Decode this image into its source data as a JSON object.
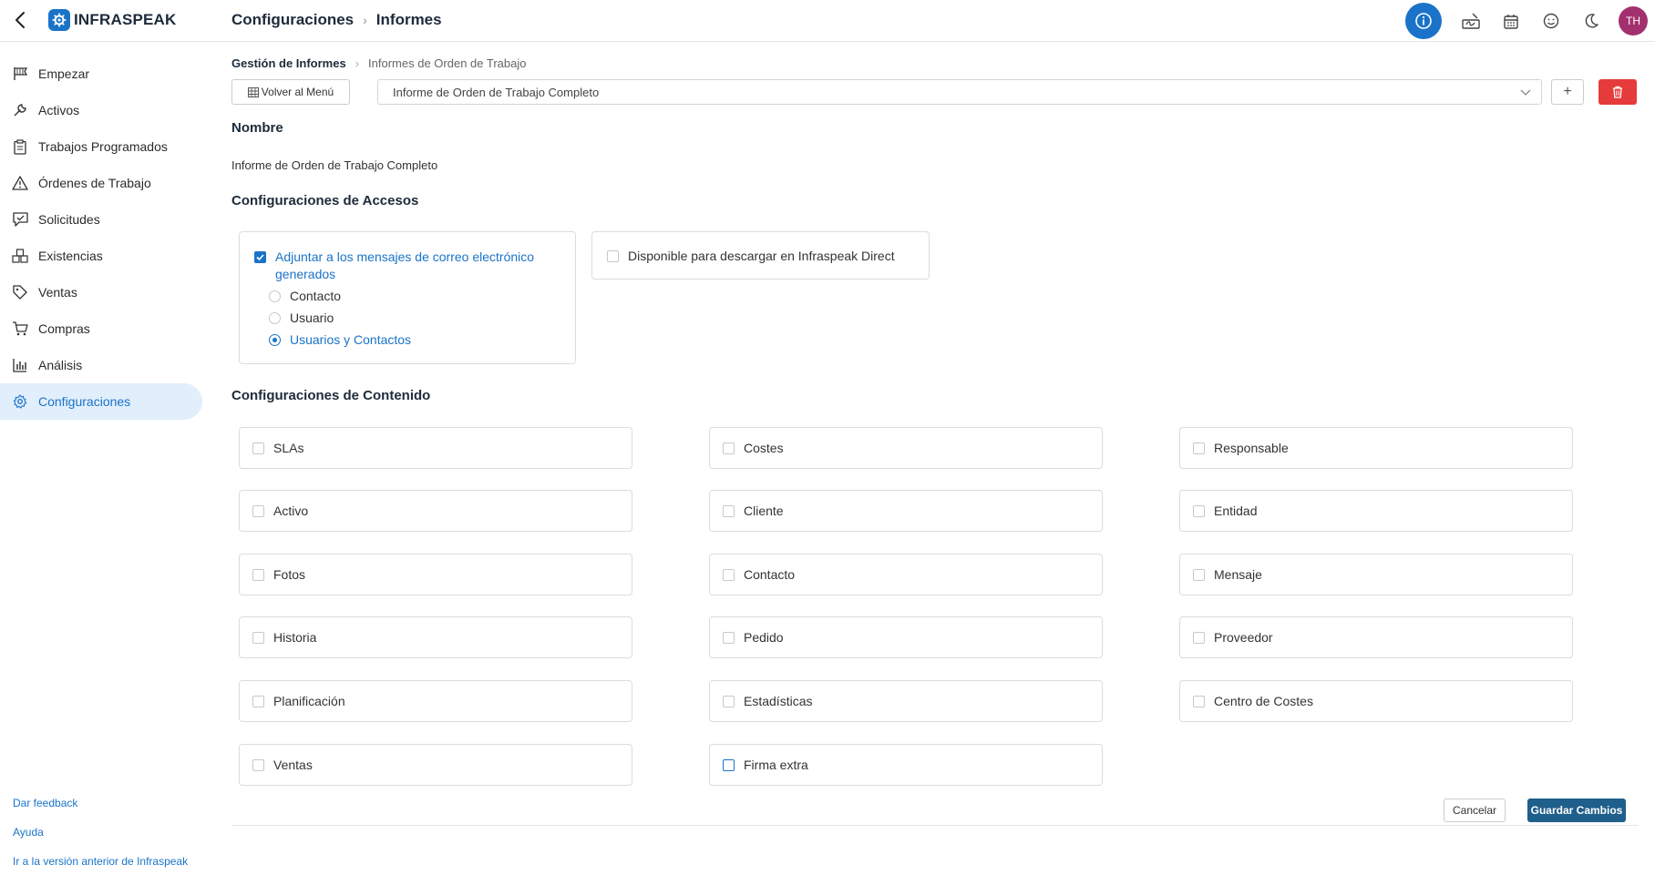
{
  "app": {
    "logo_text": "INFRASPEAK",
    "brand_color": "#1a73c8",
    "danger_color": "#e53b3b",
    "primary_button_color": "#1f5f8b"
  },
  "topbar": {
    "breadcrumb": [
      "Configuraciones",
      "Informes"
    ],
    "icons": [
      "info-icon",
      "signature-icon",
      "calendar-icon",
      "smiley-icon",
      "moon-icon"
    ],
    "avatar_initials": "TH"
  },
  "sidebar": {
    "items": [
      {
        "label": "Empezar",
        "icon": "flag-icon"
      },
      {
        "label": "Activos",
        "icon": "wrench-icon"
      },
      {
        "label": "Trabajos Programados",
        "icon": "clipboard-icon"
      },
      {
        "label": "Órdenes de Trabajo",
        "icon": "warning-triangle-icon"
      },
      {
        "label": "Solicitudes",
        "icon": "chat-check-icon"
      },
      {
        "label": "Existencias",
        "icon": "boxes-icon"
      },
      {
        "label": "Ventas",
        "icon": "tag-icon"
      },
      {
        "label": "Compras",
        "icon": "cart-icon"
      },
      {
        "label": "Análisis",
        "icon": "bar-chart-icon"
      },
      {
        "label": "Configuraciones",
        "icon": "gear-icon",
        "active": true
      }
    ],
    "footer_links": [
      "Dar feedback",
      "Ayuda",
      "Ir a la versión anterior de Infraspeak"
    ]
  },
  "main": {
    "breadcrumb": [
      "Gestión de Informes",
      "Informes de Orden de Trabajo"
    ],
    "back_button": "Volver al Menú",
    "report_select": "Informe de Orden de Trabajo Completo",
    "add_button": "+",
    "name_title": "Nombre",
    "name_value": "Informe de Orden de Trabajo Completo",
    "access_title": "Configuraciones de Accesos",
    "access": {
      "attach_label": "Adjuntar a los mensajes de correo electrónico generados",
      "attach_checked": true,
      "recipients": [
        {
          "label": "Contacto",
          "selected": false
        },
        {
          "label": "Usuario",
          "selected": false
        },
        {
          "label": "Usuarios y Contactos",
          "selected": true
        }
      ],
      "direct_label": "Disponible para descargar en Infraspeak Direct",
      "direct_checked": false
    },
    "content_title": "Configuraciones de Contenido",
    "content_options": [
      [
        "SLAs",
        "Costes",
        "Responsable"
      ],
      [
        "Activo",
        "Cliente",
        "Entidad"
      ],
      [
        "Fotos",
        "Contacto",
        "Mensaje"
      ],
      [
        "Historia",
        "Pedido",
        "Proveedor"
      ],
      [
        "Planificación",
        "Estadísticas",
        "Centro de Costes"
      ],
      [
        "Ventas",
        "Firma extra"
      ]
    ],
    "cancel_button": "Cancelar",
    "save_button": "Guardar Cambios"
  }
}
